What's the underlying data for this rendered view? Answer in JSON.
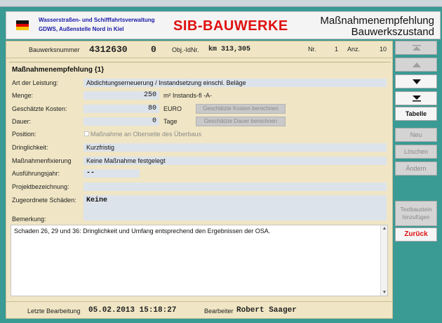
{
  "header": {
    "org_line1": "Wasserstraßen- und Schifffahrtsverwaltung",
    "org_line2": "GDWS, Außenstelle Nord in Kiel",
    "app_title": "SIB-BAUWERKE",
    "title_line1": "Maßnahmenempfehlung",
    "title_line2": "Bauwerkszustand"
  },
  "info": {
    "bauwerksnummer_label": "Bauwerksnummer",
    "bauwerksnummer": "4312630",
    "teilbauwerk": "0",
    "obj_label": "Obj.-IdNr.",
    "obj_value": "km 313,305",
    "nr_label": "Nr.",
    "nr_value": "1",
    "anz_label": "Anz.",
    "anz_value": "10"
  },
  "form": {
    "section_title": "Maßnahmenempfehlung {1}",
    "art_label": "Art der Leistung:",
    "art_value": "Abdichtungserneuerung / Instandsetzung einschl. Beläge",
    "menge_label": "Menge:",
    "menge_value": "250",
    "menge_unit": "m² Instands-fl -A-",
    "kosten_label": "Geschätzte Kosten:",
    "kosten_value": "80",
    "kosten_unit": "EURO",
    "kosten_button": "Geschätzte Kosten berechnen",
    "dauer_label": "Dauer:",
    "dauer_value": "0",
    "dauer_unit": "Tage",
    "dauer_button": "Geschätzte Dauer berechnen",
    "position_label": "Position:",
    "position_checkbox": "Maßnahme an Oberseite des Überbaus",
    "dringlichkeit_label": "Dringlichkeit:",
    "dringlichkeit_value": "Kurzfristig",
    "fixierung_label": "Maßnahmenfixierung",
    "fixierung_value": "Keine Maßnahme festgelegt",
    "jahr_label": "Ausführungsjahr:",
    "jahr_value": "--",
    "projekt_label": "Projektbezeichnung:",
    "projekt_value": "",
    "schaeden_label": "Zugeordnete Schäden:",
    "schaeden_value": "Keine",
    "bemerkung_label": "Bemerkung:",
    "bemerkung_text": "Schaden 26, 29 und 36: Dringlichkeit und Umfang entsprechend den Ergebnissen der OSA."
  },
  "footer": {
    "letzte_label": "Letzte Bearbeitung",
    "letzte_value": "05.02.2013 15:18:27",
    "bearbeiter_label": "Bearbeiter",
    "bearbeiter_value": "Robert Saager"
  },
  "sidebar": {
    "tabelle": "Tabelle",
    "neu": "Neu",
    "loeschen": "Löschen",
    "aendern": "Ändern",
    "textbaustein_line1": "Textbaustein",
    "textbaustein_line2": "hinzufügen",
    "zurueck": "Zurück"
  },
  "colors": {
    "accent_red": "#e01010",
    "org_blue": "#1a1aa8",
    "form_bg": "#f0e6c5",
    "window_teal": "#3a9a94"
  }
}
